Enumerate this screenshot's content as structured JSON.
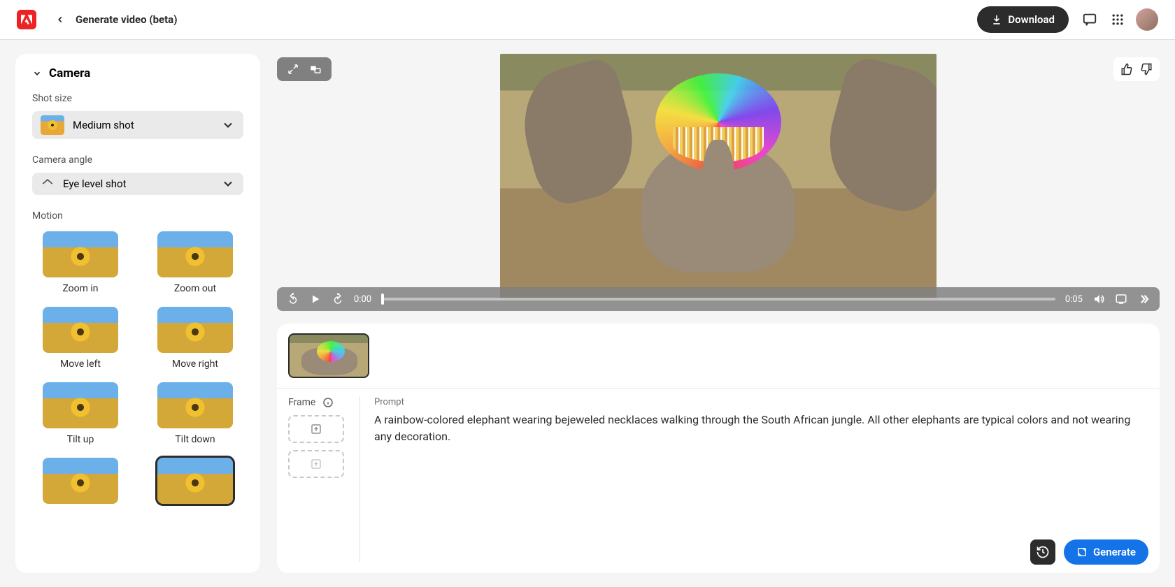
{
  "header": {
    "title": "Generate video (beta)",
    "download_label": "Download"
  },
  "sidebar": {
    "title": "Camera",
    "shot_size_label": "Shot size",
    "shot_size_value": "Medium shot",
    "camera_angle_label": "Camera angle",
    "camera_angle_value": "Eye level shot",
    "motion_label": "Motion",
    "motion_items": [
      {
        "label": "Zoom in"
      },
      {
        "label": "Zoom out"
      },
      {
        "label": "Move left"
      },
      {
        "label": "Move right"
      },
      {
        "label": "Tilt up"
      },
      {
        "label": "Tilt down"
      },
      {
        "label": ""
      },
      {
        "label": ""
      }
    ],
    "selected_motion_index": 7
  },
  "video": {
    "current_time": "0:00",
    "duration": "0:05"
  },
  "prompt_panel": {
    "frame_label": "Frame",
    "prompt_label": "Prompt",
    "prompt_text": "A rainbow-colored elephant wearing bejeweled necklaces walking through the South African jungle. All other elephants are typical colors and not wearing any decoration.",
    "generate_label": "Generate"
  }
}
